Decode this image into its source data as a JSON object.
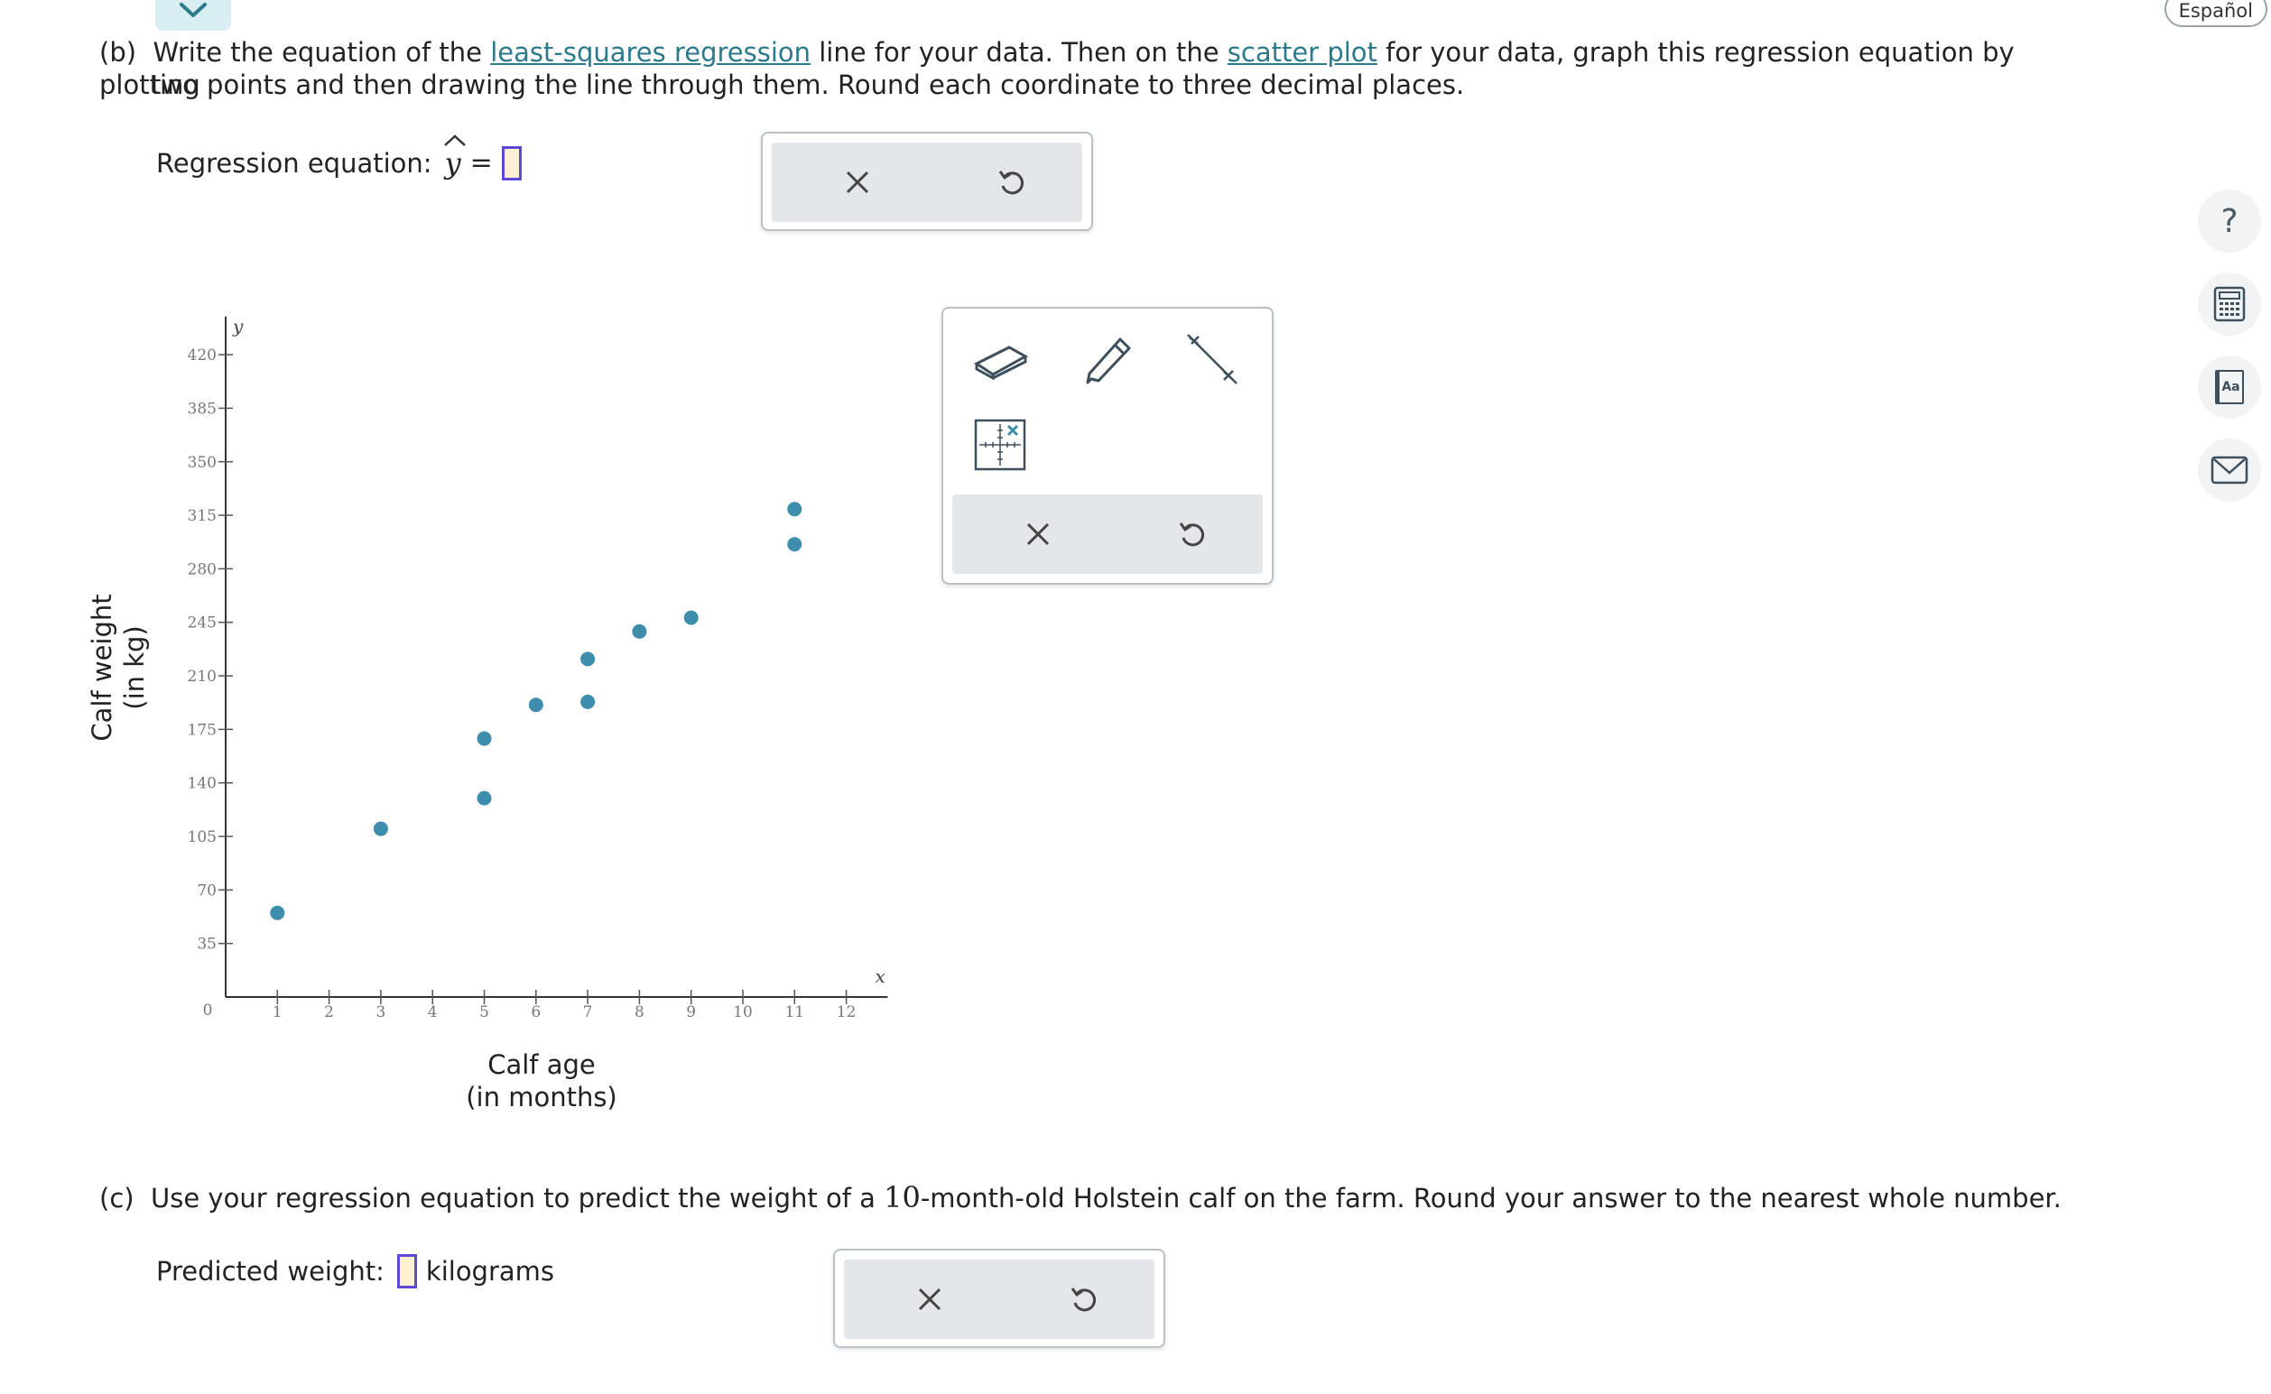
{
  "top_toggle": {
    "icon": "chevron-down-icon"
  },
  "language_button": {
    "label": "Español"
  },
  "part_b": {
    "label": "(b)",
    "text_1": "Write the equation of the ",
    "link_1": "least-squares regression",
    "text_2": " line for your data. Then on the ",
    "link_2": "scatter plot",
    "text_3": " for your data, graph this regression equation by plotting",
    "text_line2": "two points and then drawing the line through them. Round each coordinate to three decimal places.",
    "equation_label": "Regression equation:",
    "equation_var": "y",
    "equation_eq": "="
  },
  "chart_data": {
    "type": "scatter",
    "xlabel": "Calf age",
    "xlabel_sub": "(in months)",
    "ylabel": "Calf weight",
    "ylabel_sub": "(in kg)",
    "x_axis_letter": "x",
    "y_axis_letter": "y",
    "origin_label": "0",
    "xlim": [
      0,
      12.8
    ],
    "ylim": [
      0,
      445
    ],
    "x_ticks": [
      1,
      2,
      3,
      4,
      5,
      6,
      7,
      8,
      9,
      10,
      11,
      12
    ],
    "y_ticks": [
      35,
      70,
      105,
      140,
      175,
      210,
      245,
      280,
      315,
      350,
      385,
      420
    ],
    "points": [
      {
        "x": 1,
        "y": 55
      },
      {
        "x": 3,
        "y": 110
      },
      {
        "x": 5,
        "y": 130
      },
      {
        "x": 5,
        "y": 169
      },
      {
        "x": 6,
        "y": 191
      },
      {
        "x": 7,
        "y": 193
      },
      {
        "x": 7,
        "y": 221
      },
      {
        "x": 8,
        "y": 239
      },
      {
        "x": 9,
        "y": 248
      },
      {
        "x": 11,
        "y": 296
      },
      {
        "x": 11,
        "y": 319
      }
    ],
    "point_color": "#3d8ead",
    "grid": false
  },
  "graph_tools": {
    "eraser": "eraser-icon",
    "pencil": "pencil-icon",
    "line": "line-tool-icon",
    "point_grid": "point-grid-icon",
    "clear": "close-icon",
    "undo": "undo-icon"
  },
  "part_c": {
    "label": "(c)",
    "text_1": "Use your regression equation to predict the weight of a ",
    "number": "10",
    "text_2": "-month-old Holstein calf on the farm. Round your answer to the nearest whole number.",
    "answer_label": "Predicted weight:",
    "unit": "kilograms"
  },
  "answer_panel": {
    "clear": "close-icon",
    "undo": "undo-icon"
  },
  "side_tools": {
    "help": "?",
    "calculator": "calculator-icon",
    "reference": "Aa",
    "message": "mail-icon"
  }
}
